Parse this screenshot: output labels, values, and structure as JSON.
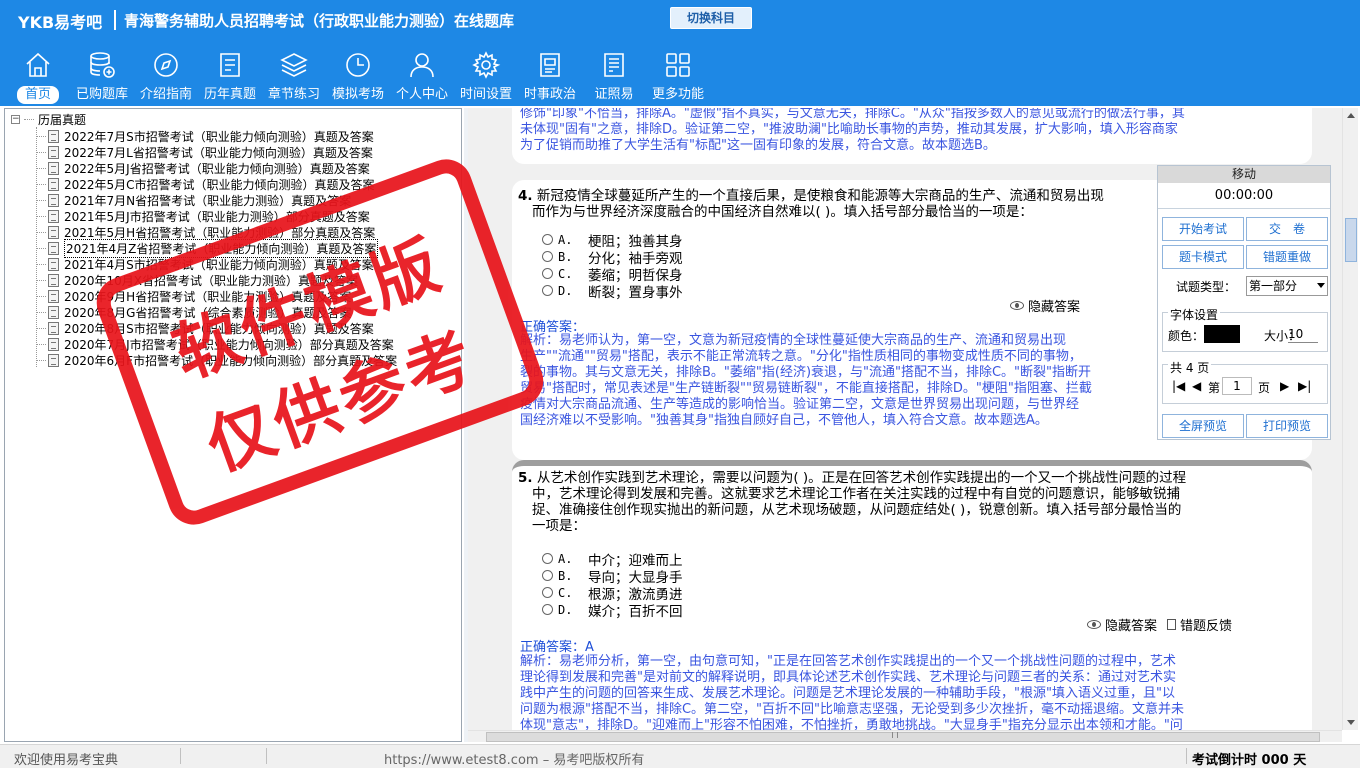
{
  "header": {
    "logo": "YKB易考吧",
    "title": "青海警务辅助人员招聘考试（行政职业能力测验）在线题库",
    "switch_label": "切换科目",
    "nav": [
      {
        "label": "首页",
        "icon": "home-icon"
      },
      {
        "label": "已购题库",
        "icon": "database-icon"
      },
      {
        "label": "介绍指南",
        "icon": "compass-icon"
      },
      {
        "label": "历年真题",
        "icon": "document-list-icon"
      },
      {
        "label": "章节练习",
        "icon": "layers-icon"
      },
      {
        "label": "模拟考场",
        "icon": "clock-icon"
      },
      {
        "label": "个人中心",
        "icon": "user-icon"
      },
      {
        "label": "时间设置",
        "icon": "gear-icon"
      },
      {
        "label": "时事政治",
        "icon": "newspaper-icon"
      },
      {
        "label": "证照易",
        "icon": "certificate-icon"
      },
      {
        "label": "更多功能",
        "icon": "grid-icon"
      }
    ]
  },
  "tree": {
    "root_label": "历届真题",
    "items": [
      "2022年7月S市招警考试（职业能力倾向测验）真题及答案",
      "2022年7月L省招警考试（职业能力倾向测验）真题及答案",
      "2022年5月J省招警考试（职业能力倾向测验）真题及答案",
      "2022年5月C市招警考试（职业能力倾向测验）真题及答案",
      "2021年7月N省招警考试（职业能力测验）真题及答案",
      "2021年5月J市招警考试（职业能力测验）部分真题及答案",
      "2021年5月H省招警考试（职业能力测验）部分真题及答案",
      "2021年4月Z省招警考试（职业能力倾向测验）真题及答案",
      "2021年4月S市招警考试（职业能力倾向测验）真题及答案",
      "2020年10月X省招警考试（职业能力测验）真题及答案",
      "2020年9月H省招警考试（职业能力测验）真题及答案",
      "2020年8月G省招警考试（综合素质测验）真题及答案",
      "2020年8月S市招警考试（职业能力倾向测验）真题及答案",
      "2020年7月J市招警考试（职业能力倾向测验）部分真题及答案",
      "2020年6月F市招警考试（职业能力倾向测验）部分真题及答案"
    ],
    "selected_index": 7
  },
  "prev_card": {
    "analysis": [
      "修饰\"印象\"不恰当，排除A。\"虚假\"指不真实，与文意无关，排除C。\"从众\"指按多数人的意见或流行的做法行事，其",
      "未体现\"固有\"之意，排除D。验证第二空，\"推波助澜\"比喻助长事物的声势，推动其发展，扩大影响，填入形容商家",
      "为了促销而助推了大学生活有\"标配\"这一固有印象的发展，符合文意。故本题选B。"
    ]
  },
  "q4": {
    "num": "4.",
    "stem": [
      "新冠疫情全球蔓延所产生的一个直接后果，是使粮食和能源等大宗商品的生产、流通和贸易出现",
      "而作为与世界经济深度融合的中国经济自然难以(  )。填入括号部分最恰当的一项是："
    ],
    "options": [
      {
        "letter": "A.",
        "text": "梗阻；独善其身"
      },
      {
        "letter": "B.",
        "text": "分化；袖手旁观"
      },
      {
        "letter": "C.",
        "text": "萎缩；明哲保身"
      },
      {
        "letter": "D.",
        "text": "断裂；置身事外"
      }
    ],
    "hide_answer": "隐藏答案",
    "answer_label": "正确答案：",
    "analysis": [
      "解析：易老师认为，第一空，文意为新冠疫情的全球性蔓延使大宗商品的生产、流通和贸易出现",
      "生产\"\"流通\"\"贸易\"搭配，表示不能正常流转之意。\"分化\"指性质相同的事物变成性质不同的事物，",
      "裂的事物。其与文意无关，排除B。\"萎缩\"指(经济)衰退，与\"流通\"搭配不当，排除C。\"断裂\"指断开",
      "贸易\"搭配时，常见表述是\"生产链断裂\"\"贸易链断裂\"，不能直接搭配，排除D。\"梗阻\"指阻塞、拦截",
      "疫情对大宗商品流通、生产等造成的影响恰当。验证第二空，文意是世界贸易出现问题，与世界经",
      "国经济难以不受影响。\"独善其身\"指独自顾好自己，不管他人，填入符合文意。故本题选A。"
    ]
  },
  "q5": {
    "num": "5.",
    "stem": [
      "从艺术创作实践到艺术理论，需要以问题为(  )。正是在回答艺术创作实践提出的一个又一个挑战性问题的过程",
      "中，艺术理论得到发展和完善。这就要求艺术理论工作者在关注实践的过程中有自觉的问题意识，能够敏锐捕",
      "捉、准确接住创作现实抛出的新问题，从艺术现场破题，从问题症结处(  )，锐意创新。填入括号部分最恰当的",
      "一项是："
    ],
    "options": [
      {
        "letter": "A.",
        "text": "中介；迎难而上"
      },
      {
        "letter": "B.",
        "text": "导向；大显身手"
      },
      {
        "letter": "C.",
        "text": "根源；激流勇进"
      },
      {
        "letter": "D.",
        "text": "媒介；百折不回"
      }
    ],
    "hide_answer": "隐藏答案",
    "feedback": "错题反馈",
    "answer_label": "正确答案：",
    "answer_value": "A",
    "analysis": [
      "解析：易老师分析，第一空，由句意可知，\"正是在回答艺术创作实践提出的一个又一个挑战性问题的过程中，艺术",
      "理论得到发展和完善\"是对前文的解释说明，即具体论述艺术创作实践、艺术理论与问题三者的关系：通过对艺术实",
      "践中产生的问题的回答来生成、发展艺术理论。问题是艺术理论发展的一种辅助手段，\"根源\"填入语义过重，且\"以",
      "问题为根源\"搭配不当，排除C。第二空，\"百折不回\"比喻意志坚强，无论受到多少次挫折，毫不动摇退缩。文意并未",
      "体现\"意志\"，排除D。\"迎难而上\"形容不怕困难，不怕挫折，勇敢地挑战。\"大显身手\"指充分显示出本领和才能。\"问"
    ]
  },
  "tool": {
    "title": "移动",
    "timer": "00:00:00",
    "start_exam": "开始考试",
    "submit": "交　卷",
    "card_mode": "题卡模式",
    "redo_wrong": "错题重做",
    "type_label": "试题类型：",
    "type_value": "第一部分",
    "font_group": "字体设置",
    "color_label": "颜色：",
    "size_label": "大小：",
    "size_value": "10",
    "pages_label": "共 4 页",
    "page_prefix": "第",
    "page_value": "1",
    "page_suffix": "页",
    "fullscreen": "全屏预览",
    "print": "打印预览"
  },
  "status": {
    "welcome": "欢迎使用易考宝典",
    "copyright": "https://www.etest8.com – 易考吧版权所有",
    "countdown": "考试倒计时 000 天"
  },
  "stamp": {
    "line1": "软件模版",
    "line2": "仅供参考"
  },
  "colors": {
    "header_bg": "#1e88e5",
    "analysis_text": "#3a55e0",
    "stamp_red": "#e8141b"
  }
}
